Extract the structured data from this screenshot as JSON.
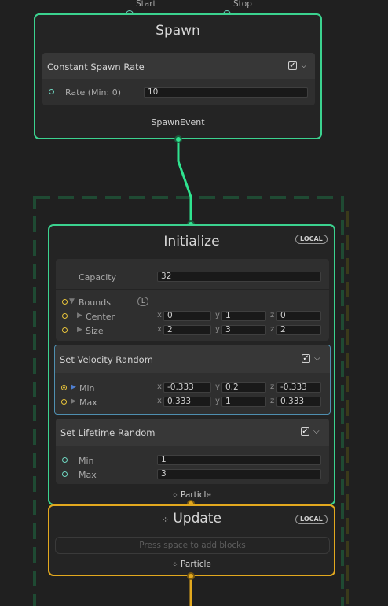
{
  "spawn": {
    "port_start": "Start",
    "port_stop": "Stop",
    "title": "Spawn",
    "block": {
      "title": "Constant Spawn Rate",
      "rate_label": "Rate (Min: 0)",
      "rate_value": "10"
    },
    "output_label": "SpawnEvent"
  },
  "initialize": {
    "title": "Initialize",
    "space_badge": "LOCAL",
    "capacity_label": "Capacity",
    "capacity_value": "32",
    "bounds_label": "Bounds",
    "bounds_badge": "L",
    "center_label": "Center",
    "center": {
      "x": "0",
      "y": "1",
      "z": "0"
    },
    "size_label": "Size",
    "size": {
      "x": "2",
      "y": "3",
      "z": "2"
    },
    "output_label": "Particle"
  },
  "velocity": {
    "title": "Set Velocity Random",
    "min_label": "Min",
    "min": {
      "x": "-0.333",
      "y": "0.2",
      "z": "-0.333"
    },
    "max_label": "Max",
    "max": {
      "x": "0.333",
      "y": "1",
      "z": "0.333"
    }
  },
  "lifetime": {
    "title": "Set Lifetime Random",
    "min_label": "Min",
    "min_value": "1",
    "max_label": "Max",
    "max_value": "3"
  },
  "update": {
    "title": "Update",
    "space_badge": "LOCAL",
    "placeholder": "Press space to add blocks",
    "output_label": "Particle"
  },
  "axes": {
    "x": "x",
    "y": "y",
    "z": "z"
  },
  "colors": {
    "context_border": "#3bd28f",
    "flow_link": "#2fe38f",
    "particle_border": "#e2a81e",
    "annotation": "#d01a1a",
    "system_outline": "#1f4a33"
  }
}
